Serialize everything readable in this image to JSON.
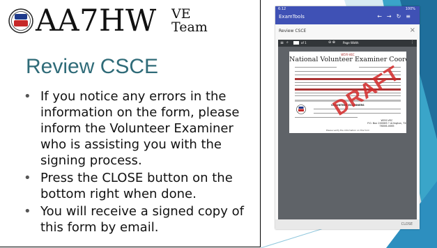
{
  "slide": {
    "logo": {
      "seal_text_top": "HAM",
      "seal_text_bottom": "IT UP",
      "callsign": "AA7HW",
      "ve": "VE",
      "team": "Team"
    },
    "title": "Review CSCE",
    "bullets": [
      "If you notice any errors in the information on the form, please inform the Volunteer Examiner who is assisting you with the signing process.",
      "Press the CLOSE button on the bottom right when done.",
      "You will receive a signed copy of this form by email."
    ],
    "bullet_glyph": "•"
  },
  "phone": {
    "status_time": "6:12",
    "status_battery": "100%",
    "app_title": "ExamTools",
    "nav_icons": [
      "back-arrow-icon",
      "forward-arrow-icon",
      "refresh-icon",
      "menu-icon"
    ],
    "dialog_title": "Review CSCE",
    "viewer": {
      "page_of": "of 1",
      "page_width": "Page Width"
    },
    "document": {
      "header_small": "W5YI-VEC",
      "heading": "National Volunteer Examiner Coordinator",
      "watermark": "DRAFT",
      "section_label": "VOLUNTEER EXAMINERS",
      "address_org": "W5YI-VEC",
      "address_line": "P.O. Box 200065 • Arlington, TX 76006-0065",
      "footer": "Please verify the information on this form"
    },
    "close_label": "CLOSE"
  },
  "colors": {
    "title": "#2f6b78",
    "appbar": "#3f51b5",
    "decor_blue": "#2d8fbf",
    "decor_teal": "#3aa5c9",
    "watermark": "#d22828"
  }
}
